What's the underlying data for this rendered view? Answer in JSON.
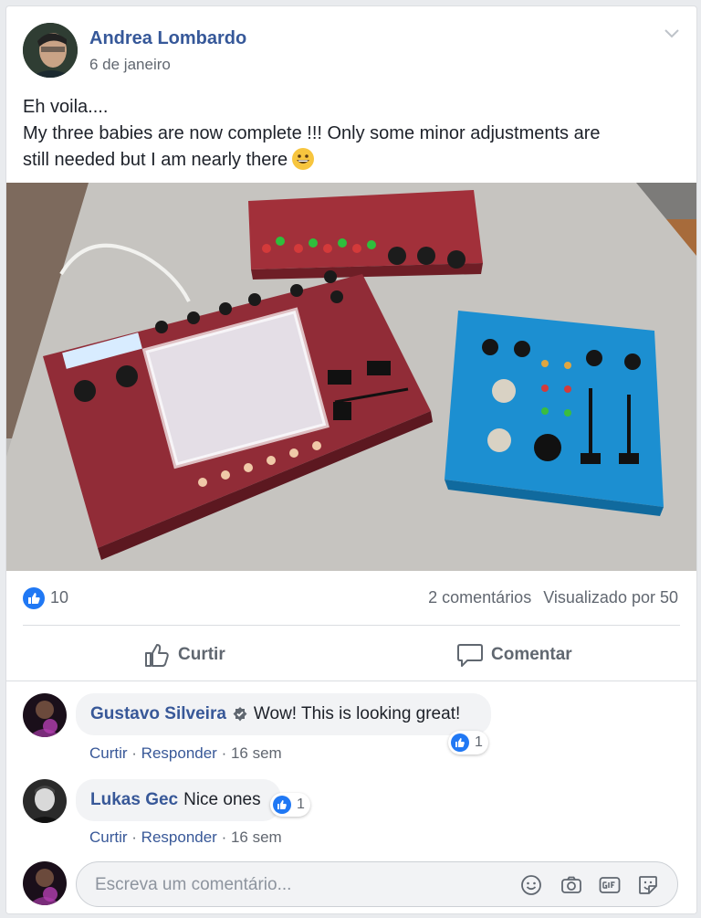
{
  "post": {
    "author": "Andrea Lombardo",
    "date": "6 de janeiro",
    "text_line1": "Eh voila....",
    "text_line2": "My three babies are now complete !!! Only some minor adjustments are",
    "text_line3": "still needed but I am nearly there"
  },
  "stats": {
    "like_count": "10",
    "comments": "2 comentários",
    "views": "Visualizado por 50"
  },
  "actions": {
    "like_label": "Curtir",
    "comment_label": "Comentar"
  },
  "comments": [
    {
      "author": "Gustavo Silveira",
      "text": "Wow! This is looking great!",
      "reaction_count": "1",
      "like_label": "Curtir",
      "reply_label": "Responder",
      "time": "16 sem"
    },
    {
      "author": "Lukas Gec",
      "text": "Nice ones",
      "reaction_count": "1",
      "like_label": "Curtir",
      "reply_label": "Responder",
      "time": "16 sem"
    }
  ],
  "composer": {
    "placeholder": "Escreva um comentário..."
  },
  "colors": {
    "link": "#365899",
    "like_blue": "#2078f4",
    "device_red": "#8e2a33",
    "device_blue": "#1c8fd1"
  }
}
